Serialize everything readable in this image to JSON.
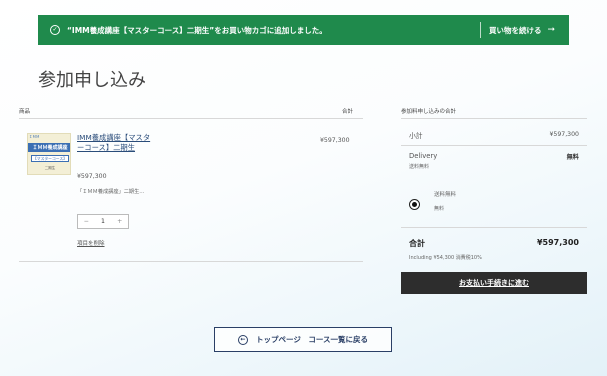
{
  "notice": {
    "message": "“IMM養成講座【マスターコース】二期生”をお買い物カゴに追加しました。",
    "continue_label": "買い物を続ける",
    "check_icon": "check-circle-icon",
    "arrow_icon": "arrow-right-icon",
    "color": "#1f8a4c"
  },
  "page": {
    "title": "参加申し込み"
  },
  "cart": {
    "headers": {
      "product": "商品",
      "total": "合計"
    },
    "items": [
      {
        "name": "IMM養成講座【マスターコース】二期生",
        "price": "¥597,300",
        "description": "「ＩＭＭ養成講座」二期生…",
        "quantity": "1",
        "minus": "−",
        "plus": "+",
        "remove_label": "項目を削除",
        "line_total": "¥597,300",
        "thumbnail": {
          "corner": "ＩＭＭ",
          "title": "ＩＭＭ養成講座",
          "subtitle": "【マスターコース】",
          "caption": "二期生"
        }
      }
    ]
  },
  "summary": {
    "heading": "参加料申し込みの合計",
    "subtotal_label": "小計",
    "subtotal_value": "¥597,300",
    "delivery_label": "Delivery",
    "delivery_sub": "送料無料",
    "delivery_value": "無料",
    "shipping_option_label": "送料無料",
    "shipping_option_sub": "無料",
    "total_label": "合計",
    "total_value": "¥597,300",
    "tax_note": "Including ¥54,300 消費税10%",
    "checkout_label": "お支払い手続きに進む"
  },
  "back_button": {
    "label": "トップページ　コース一覧に戻る",
    "icon": "arrow-left-circle-icon"
  }
}
